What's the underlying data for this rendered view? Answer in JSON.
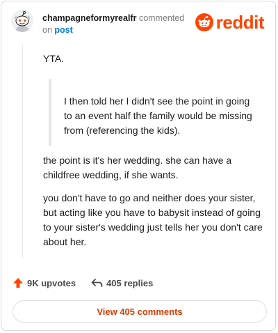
{
  "header": {
    "username": "champagneformyrealfr",
    "action_text": "commented",
    "on_text": "on",
    "post_link": "post"
  },
  "brand": {
    "name": "reddit",
    "color": "#ff4500"
  },
  "comment": {
    "paragraph_1": "YTA.",
    "quote": "I then told her I didn't see the point in going to an event half the family would be missing from (referencing the kids).",
    "paragraph_2": "the point is it's her wedding. she can have a childfree wedding, if she wants.",
    "paragraph_3": "you don't have to go and neither does your sister, but acting like you have to babysit instead of going to your sister's wedding just tells her you don't care about her."
  },
  "actions": {
    "upvotes_label": "9K upvotes",
    "replies_label": "405 replies",
    "view_comments_label": "View 405 comments"
  },
  "colors": {
    "upvote": "#ff4500",
    "view_button_text": "#d93a00",
    "link": "#0079d3"
  }
}
